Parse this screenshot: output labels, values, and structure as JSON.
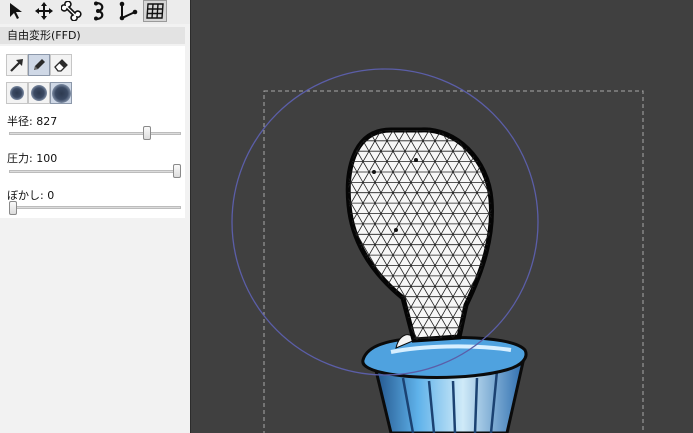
{
  "toolbar": {
    "tools": [
      {
        "icon": "select-arrow-icon"
      },
      {
        "icon": "move-icon"
      },
      {
        "icon": "bone-icon"
      },
      {
        "icon": "curve-icon"
      },
      {
        "icon": "vertex-icon"
      },
      {
        "icon": "mesh-grid-icon",
        "active": true
      }
    ]
  },
  "ffd": {
    "title": "自由変形(FFD)",
    "modes": [
      {
        "icon": "push-arrow-icon"
      },
      {
        "icon": "pencil-icon",
        "selected": true
      },
      {
        "icon": "eraser-icon"
      }
    ],
    "brushes": [
      {
        "icon": "brush-small-icon"
      },
      {
        "icon": "brush-medium-icon"
      },
      {
        "icon": "brush-large-icon",
        "selected": true
      }
    ],
    "radius": {
      "label": "半径:",
      "value": "827",
      "fraction": 0.82
    },
    "pressure": {
      "label": "圧力:",
      "value": "100",
      "fraction": 1.0
    },
    "blur": {
      "label": "ぼかし:",
      "value": "0",
      "fraction": 0.0
    }
  },
  "colors": {
    "canvas_bg": "#404040",
    "panel_bg": "#f2f2f2",
    "brush_circle": "#5b5ea8",
    "guide_box": "#a8a8a8",
    "cup_blue": "#4fa2df"
  }
}
